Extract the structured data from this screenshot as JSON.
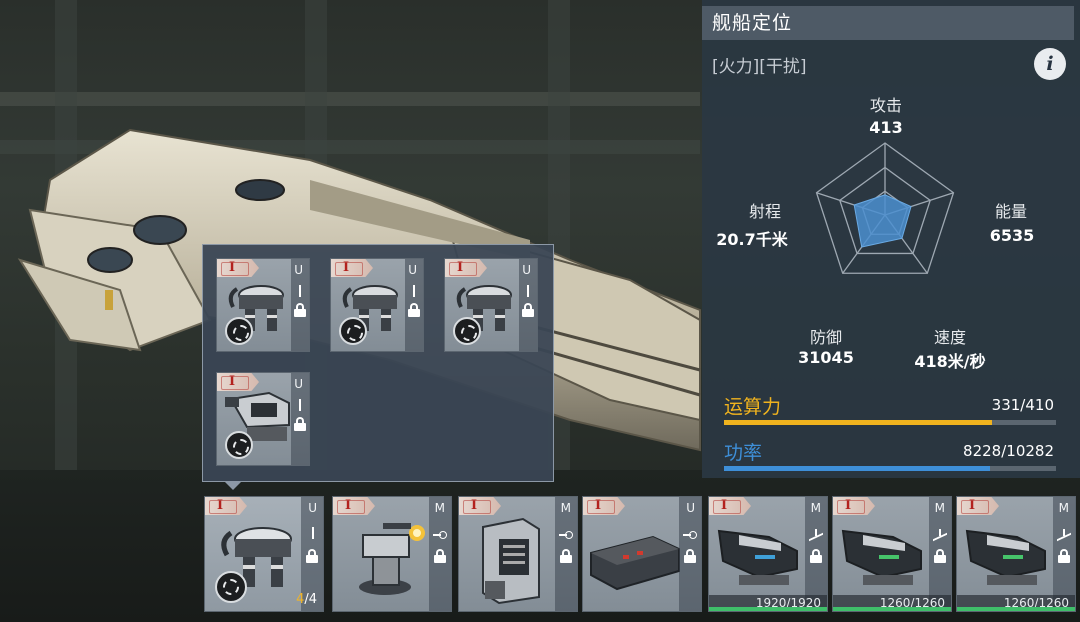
{
  "panel": {
    "title": "舰船定位",
    "tags": "[火力][干扰]",
    "info_icon": "i",
    "stats": {
      "attack_label": "攻击",
      "attack_value": "413",
      "energy_label": "能量",
      "energy_value": "6535",
      "speed_label": "速度",
      "speed_value": "418米/秒",
      "defense_label": "防御",
      "defense_value": "31045",
      "range_label": "射程",
      "range_value": "20.7千米"
    },
    "radar_levels": {
      "attack": 0.28,
      "energy": 0.38,
      "speed": 0.4,
      "defense": 0.55,
      "range": 0.45
    },
    "compute": {
      "label": "运算力",
      "value": "331/410",
      "fraction": 0.807,
      "color": "#f0b31e"
    },
    "power": {
      "label": "功率",
      "value": "8228/10282",
      "fraction": 0.8,
      "color": "#3e8fd8"
    }
  },
  "popup": {
    "items": [
      {
        "tier": "I",
        "slot": "U",
        "module": "claw-turret"
      },
      {
        "tier": "I",
        "slot": "U",
        "module": "claw-turret"
      },
      {
        "tier": "I",
        "slot": "U",
        "module": "claw-turret"
      },
      {
        "tier": "I",
        "slot": "U",
        "module": "cannon-turret"
      }
    ]
  },
  "modules": [
    {
      "tier": "I",
      "slot": "U",
      "count_current": "4",
      "count_total": "/4",
      "module": "claw-turret"
    },
    {
      "tier": "I",
      "slot": "M",
      "module": "flak-turret"
    },
    {
      "tier": "I",
      "slot": "M",
      "module": "generator"
    },
    {
      "tier": "I",
      "slot": "U",
      "module": "armor-plate"
    },
    {
      "tier": "I",
      "slot": "M",
      "hp": "1920/1920",
      "hp_fraction": 1.0,
      "module": "fighter-craft"
    },
    {
      "tier": "I",
      "slot": "M",
      "hp": "1260/1260",
      "hp_fraction": 1.0,
      "module": "fighter-craft"
    },
    {
      "tier": "I",
      "slot": "M",
      "hp": "1260/1260",
      "hp_fraction": 1.0,
      "module": "fighter-craft"
    }
  ]
}
